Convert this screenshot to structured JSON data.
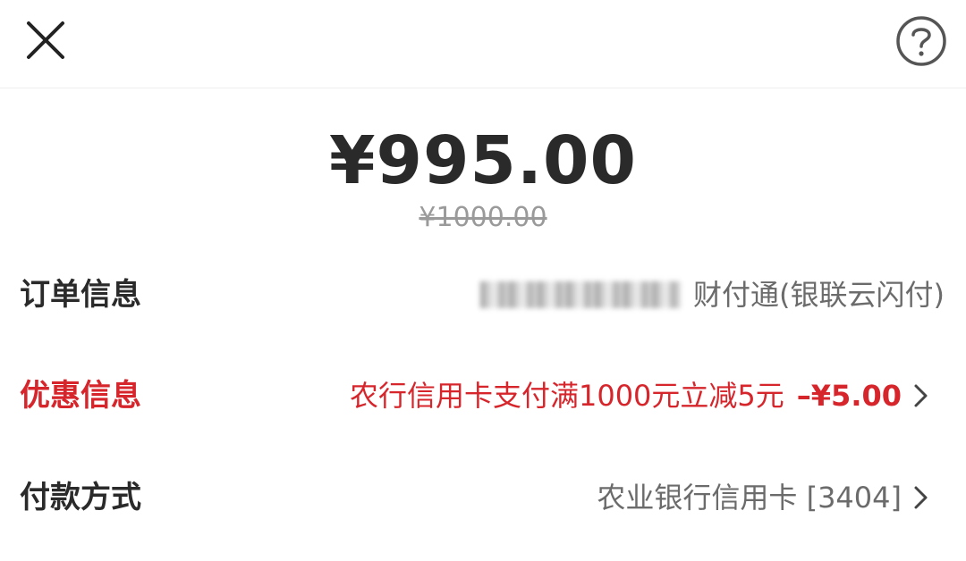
{
  "header": {
    "close_icon": "close-icon",
    "help_icon": "help-circle-icon"
  },
  "amount": {
    "current": "¥995.00",
    "original": "¥1000.00"
  },
  "order_info": {
    "label": "订单信息",
    "value": "财付通(银联云闪付)"
  },
  "discount_info": {
    "label": "优惠信息",
    "description": "农行信用卡支付满1000元立减5元",
    "amount": "–¥5.00"
  },
  "payment_method": {
    "label": "付款方式",
    "value": "农业银行信用卡 [3404]"
  },
  "colors": {
    "accent_red": "#d6262c",
    "text_dark": "#2a2a2a",
    "text_gray": "#6b6b6b",
    "strikethrough_gray": "#9a9a9a"
  }
}
